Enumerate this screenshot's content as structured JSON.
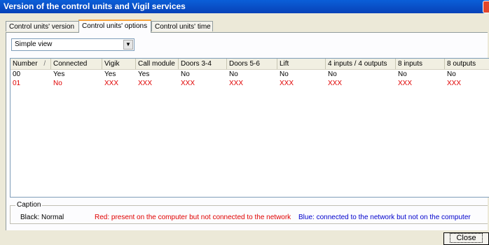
{
  "window": {
    "title": "Version of the control units and Vigil services"
  },
  "tabs": [
    {
      "label": "Control units' version"
    },
    {
      "label": "Control units' options"
    },
    {
      "label": "Control units' time"
    }
  ],
  "view_select": {
    "value": "Simple view"
  },
  "grid": {
    "sort_indicator": "/",
    "headers": [
      "Number",
      "Connected",
      "Vigik",
      "Call module",
      "Doors 3-4",
      "Doors 5-6",
      "Lift",
      "4 inputs / 4 outputs",
      "8 inputs",
      "8 outputs"
    ],
    "rows": [
      {
        "status": "normal",
        "cells": [
          "00",
          "Yes",
          "Yes",
          "Yes",
          "No",
          "No",
          "No",
          "No",
          "No",
          "No"
        ]
      },
      {
        "status": "red",
        "cells": [
          "01",
          "No",
          "XXX",
          "XXX",
          "XXX",
          "XXX",
          "XXX",
          "XXX",
          "XXX",
          "XXX"
        ]
      }
    ]
  },
  "caption": {
    "legend": "Caption",
    "black": "Black: Normal",
    "red": "Red: present on the computer but not connected to the network",
    "blue": "Blue: connected to the network but not on the computer"
  },
  "buttons": {
    "close": "Close"
  },
  "colors": {
    "red_text": "#e00000",
    "blue_text": "#0000cc",
    "title_bar": "#0a5fd8"
  }
}
